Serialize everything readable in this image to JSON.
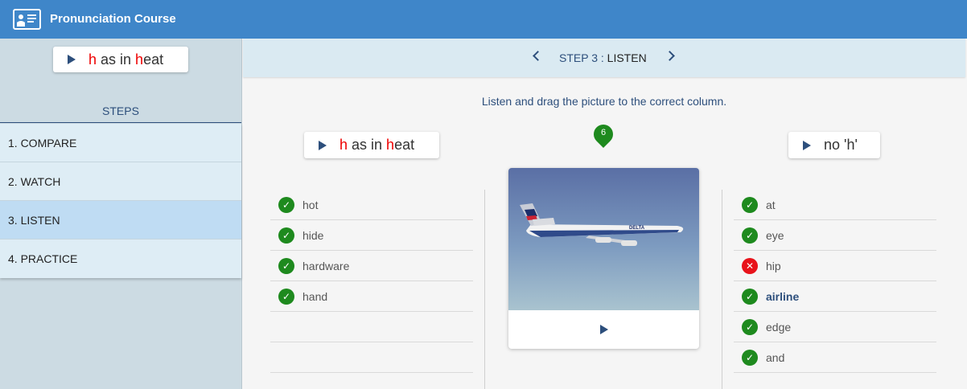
{
  "app": {
    "title": "Pronunciation Course",
    "icon": "presenter-board-icon"
  },
  "sidebar": {
    "sound": {
      "letter": "h",
      "middle": " as in ",
      "word_letter": "h",
      "word_rest": "eat"
    },
    "steps_heading": "STEPS",
    "steps": [
      {
        "label": "1. COMPARE"
      },
      {
        "label": "2. WATCH"
      },
      {
        "label": "3. LISTEN",
        "active": true
      },
      {
        "label": "4. PRACTICE"
      }
    ]
  },
  "step_header": {
    "prefix": "STEP 3 : ",
    "name": "LISTEN"
  },
  "instruction": "Listen and drag the picture to the correct column.",
  "left_column": {
    "sound": {
      "letter": "h",
      "middle": " as in ",
      "word_letter": "h",
      "word_rest": "eat"
    },
    "items": [
      {
        "word": "hot",
        "status": "correct"
      },
      {
        "word": "hide",
        "status": "correct"
      },
      {
        "word": "hardware",
        "status": "correct"
      },
      {
        "word": "hand",
        "status": "correct"
      }
    ]
  },
  "counter": "6",
  "right_column": {
    "label": "no 'h'",
    "items": [
      {
        "word": "at",
        "status": "correct"
      },
      {
        "word": "eye",
        "status": "correct"
      },
      {
        "word": "hip",
        "status": "wrong"
      },
      {
        "word": "airline",
        "status": "correct"
      },
      {
        "word": "edge",
        "status": "correct"
      },
      {
        "word": "and",
        "status": "correct"
      }
    ]
  },
  "picture": {
    "image_text": "DELTA",
    "accent": "#2d4f7c"
  },
  "colors": {
    "topbar": "#3f86c9",
    "correct": "#1e8a1e",
    "wrong": "#e8131b",
    "highlight": "#e00000"
  }
}
